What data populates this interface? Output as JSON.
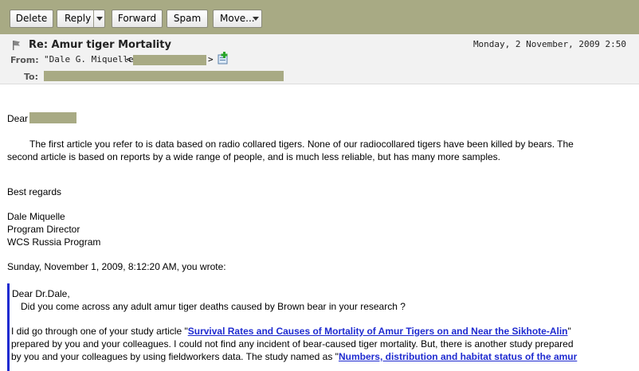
{
  "toolbar": {
    "delete_label": "Delete",
    "reply_label": "Reply",
    "forward_label": "Forward",
    "spam_label": "Spam",
    "move_label": "Move..."
  },
  "message": {
    "subject": "Re: Amur tiger Mortality",
    "date": "Monday, 2 November, 2009 2:50",
    "from_label": "From:",
    "from_name": "\"Dale G. Miquelle\"",
    "to_label": "To:"
  },
  "body": {
    "greeting": "Dear",
    "para1_line1": "The first article you refer to is data based on radio collared tigers. None of our radiocollared tigers have been killed by bears.  The",
    "para1_line2": "second article is based on reports by a wide range of people, and is much less reliable, but has many more samples.",
    "closing": "Best regards",
    "sig_name": "Dale Miquelle",
    "sig_title": "Program Director",
    "sig_org": "WCS Russia Program",
    "quote_header": "Sunday, November 1, 2009, 8:12:20 AM, you wrote:"
  },
  "quoted": {
    "greeting": "Dear Dr.Dale,",
    "question": "Did you come across any adult amur tiger deaths caused by Brown bear in your research ?",
    "line1_pre": "I did go through one of your study article \"",
    "line1_link": "Survival Rates and Causes of Mortality of Amur Tigers on and Near the Sikhote-Alin",
    "line1_post": "\"",
    "line2": "prepared by you and your colleagues. I could not find any incident of bear-caused tiger mortality. But, there is another study prepared",
    "line3_pre": "by you and your colleagues by using fieldworkers data. The study named as \"",
    "line3_link": "Numbers, distribution and habitat status of the amur"
  },
  "colors": {
    "toolbar_bg": "#a8aa84",
    "redaction": "#a8aa84",
    "link": "#1f2bd0",
    "quote_bar": "#1f2bd0",
    "header_bg": "#f2f2f2"
  },
  "icons": {
    "flag": "flag-icon",
    "add_contact": "add-contact-icon",
    "dropdown": "chevron-down-icon"
  }
}
